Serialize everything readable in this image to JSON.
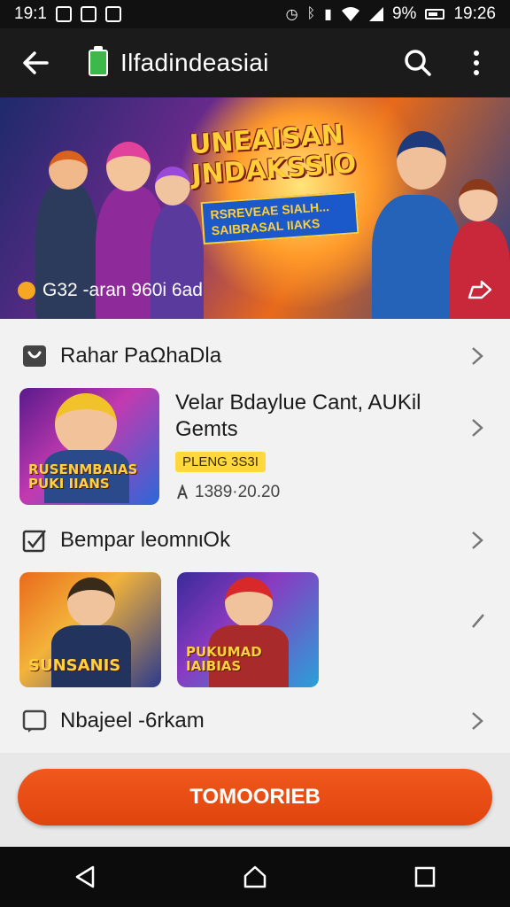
{
  "status_bar": {
    "time_left": "19:1",
    "battery_pct": "9%",
    "time_right": "19:26"
  },
  "app_bar": {
    "title": "Ilfadindeasiai"
  },
  "banner": {
    "heading": "UNEAISAN JNDAKSSIO",
    "tag": "RSREVEAE SIALH... SAIBRASAL IIAKS",
    "caption": "G32 -aran 960i 6ad"
  },
  "sections": {
    "section1_label": "Rahar PaΩhaDla",
    "section2_label": "Bempar leomnιOk",
    "section3_label": "Nbajeel -6rkam"
  },
  "game": {
    "title": "Velar Bdaylue Cant, AUKil Gemts",
    "badge": "PLENG 3S3I",
    "meta": "1389·20.20",
    "thumb_text": "RUSENMBAIAS PUKI IIANS"
  },
  "thumbs": {
    "left_text": "SUNSANIS",
    "right_text": "PUKUMAD IAIBIAS"
  },
  "cta": {
    "label": "TOMOORIEB"
  },
  "colors": {
    "accent": "#e9501a",
    "badge": "#ffd83d",
    "app_bar": "#1b1b1b"
  }
}
